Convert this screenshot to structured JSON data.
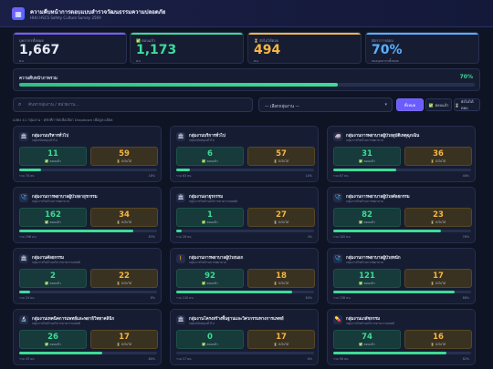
{
  "header": {
    "logo": "▦",
    "title": "ความคืบหน้าการตอบแบบสำรวจวัฒนธรรมความปลอดภัย",
    "subtitle": "HHU HSCS Safety Culture Survey 2569"
  },
  "stats": [
    {
      "label": "บุคลากรทั้งหมด",
      "value": "1,667",
      "unit": "คน",
      "color": "#e6ebf5",
      "bar": "#7c5cff"
    },
    {
      "label": "✅ ตอบแล้ว",
      "value": "1,173",
      "unit": "คน",
      "color": "#3ddc97",
      "bar": "#3ddc97"
    },
    {
      "label": "⏳ ยังไม่ได้ตอบ",
      "value": "494",
      "unit": "คน",
      "color": "#f5b642",
      "bar": "#f5b642"
    },
    {
      "label": "อัตราการตอบ",
      "value": "70%",
      "unit": "ของบุคลากรทั้งหมด",
      "color": "#5ab0ff",
      "bar": "#5ab0ff"
    }
  ],
  "overall": {
    "label": "ความคืบหน้าภาพรวม",
    "pct_text": "70%",
    "pct": 0.7
  },
  "search": {
    "icon": "⌕",
    "placeholder": "ค้นหากลุ่มงาน / หน่วยงาน..."
  },
  "select": {
    "value": "— เลือกกลุ่มงาน —",
    "chevron": "▾"
  },
  "filters": [
    {
      "label": "ทั้งหมด",
      "icon": "",
      "active": true
    },
    {
      "label": "ตอบแล้ว",
      "icon": "✅",
      "active": false
    },
    {
      "label": "ยังไม่ได้ตอบ",
      "icon": "⏳",
      "active": false
    }
  ],
  "hint": "แสดง 41 กลุ่มงาน · คลิกที่การ์ดเพื่อเลือก Dropdown เพื่อดูละเอียด",
  "labels": {
    "done": "✅ ตอบแล้ว",
    "pend": "⏳ ยังไม่ได้"
  },
  "cards": [
    {
      "icon": "🏛",
      "name": "กลุ่มงานบริหารทั่วไป",
      "sub": "กลุ่มสนับสนุนทั่วไป",
      "done": "11",
      "pend": "59",
      "total": "รวม 70 คน",
      "pct_text": "16%",
      "pct": 0.16
    },
    {
      "icon": "🏛",
      "name": "กลุ่มงานบริการทั่วไป",
      "sub": "กลุ่มสนับสนุนทั่วไป",
      "done": "6",
      "pend": "57",
      "total": "รวม 63 คน",
      "pct_text": "10%",
      "pct": 0.1
    },
    {
      "icon": "🚑",
      "name": "กลุ่มงานการพยาบาลผู้ป่วยอุบัติเหตุฉุกเฉิน",
      "sub": "กลุ่มภารกิจด้านการพยาบาล",
      "done": "31",
      "pend": "36",
      "total": "รวม 67 คน",
      "pct_text": "46%",
      "pct": 0.46
    },
    {
      "icon": "🩺",
      "name": "กลุ่มงานการพยาบาลผู้ป่วยอายุรกรรม",
      "sub": "กลุ่มภารกิจด้านการพยาบาล",
      "done": "162",
      "pend": "34",
      "total": "รวม 196 คน",
      "pct_text": "83%",
      "pct": 0.83
    },
    {
      "icon": "🏛",
      "name": "กลุ่มงานอายุรกรรม",
      "sub": "กลุ่มภารกิจด้านบริการทางการแพทย์",
      "done": "1",
      "pend": "27",
      "total": "รวม 28 คน",
      "pct_text": "4%",
      "pct": 0.04
    },
    {
      "icon": "🩺",
      "name": "กลุ่มงานการพยาบาลผู้ป่วยศัลยกรรม",
      "sub": "กลุ่มภารกิจด้านการพยาบาล",
      "done": "82",
      "pend": "23",
      "total": "รวม 105 คน",
      "pct_text": "78%",
      "pct": 0.78
    },
    {
      "icon": "🏛",
      "name": "กลุ่มงานศัลยกรรม",
      "sub": "กลุ่มภารกิจด้านบริการทางการแพทย์",
      "done": "2",
      "pend": "22",
      "total": "รวม 24 คน",
      "pct_text": "8%",
      "pct": 0.08
    },
    {
      "icon": "🚶",
      "name": "กลุ่มงานการพยาบาลผู้ป่วยนอก",
      "sub": "กลุ่มภารกิจด้านการพยาบาล",
      "done": "92",
      "pend": "18",
      "total": "รวม 110 คน",
      "pct_text": "84%",
      "pct": 0.84
    },
    {
      "icon": "🩺",
      "name": "กลุ่มงานการพยาบาลผู้ป่วยหนัก",
      "sub": "กลุ่มภารกิจด้านการพยาบาล",
      "done": "121",
      "pend": "17",
      "total": "รวม 138 คน",
      "pct_text": "88%",
      "pct": 0.88
    },
    {
      "icon": "🔬",
      "name": "กลุ่มงานเทคนิคการแพทย์และพยาธิวิทยาคลินิก",
      "sub": "กลุ่มภารกิจด้านบริการทางการแพทย์",
      "done": "26",
      "pend": "17",
      "total": "รวม 43 คน",
      "pct_text": "60%",
      "pct": 0.6
    },
    {
      "icon": "🏛",
      "name": "กลุ่มงานโครงสร้างพื้นฐานและวิศวกรรมทางการแพทย์",
      "sub": "กลุ่มสนับสนุนทั่วไป",
      "done": "0",
      "pend": "17",
      "total": "รวม 17 คน",
      "pct_text": "0%",
      "pct": 0.0
    },
    {
      "icon": "💊",
      "name": "กลุ่มงานเภสัชกรรม",
      "sub": "กลุ่มภารกิจด้านบริการทางการแพทย์",
      "done": "74",
      "pend": "16",
      "total": "รวม 90 คน",
      "pct_text": "82%",
      "pct": 0.82
    }
  ]
}
